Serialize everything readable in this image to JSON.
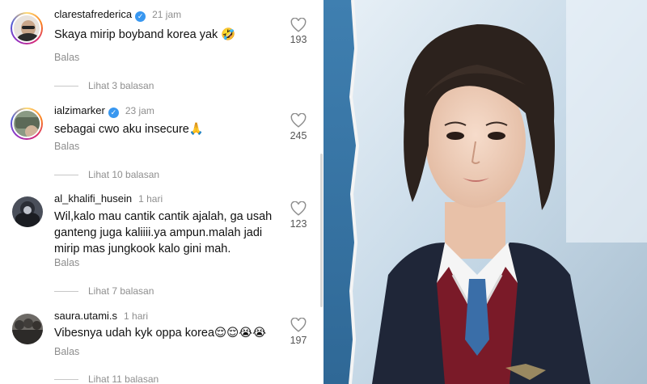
{
  "comments": [
    {
      "username": "clarestafrederica",
      "verified": true,
      "time": "21 jam",
      "text": "Skaya mirip boyband korea yak 🤣",
      "likes": "193",
      "reply_label": "Balas",
      "view_replies": "Lihat 3 balasan"
    },
    {
      "username": "ialzimarker",
      "verified": true,
      "time": "23 jam",
      "text": "sebagai cwo aku insecure🙏",
      "likes": "245",
      "reply_label": "Balas",
      "view_replies": "Lihat 10 balasan"
    },
    {
      "username": "al_khalifi_husein",
      "verified": false,
      "time": "1 hari",
      "text": "Wil,kalo mau cantik cantik ajalah, ga usah ganteng juga kaliiii.ya ampun.malah jadi mirip mas jungkook kalo gini mah.",
      "likes": "123",
      "reply_label": "Balas",
      "view_replies": "Lihat 7 balasan"
    },
    {
      "username": "saura.utami.s",
      "verified": false,
      "time": "1 hari",
      "text": "Vibesnya udah kyk oppa korea😌😌😭😭",
      "likes": "197",
      "reply_label": "Balas",
      "view_replies": "Lihat 11 balasan"
    }
  ],
  "icons": {
    "heart": "heart-outline-icon",
    "verified": "verified-badge-icon"
  },
  "colors": {
    "verified_blue": "#3897f0",
    "meta_gray": "#8e8e8e",
    "blazer": "#1f2638",
    "tie_red": "#8b1e2c"
  }
}
